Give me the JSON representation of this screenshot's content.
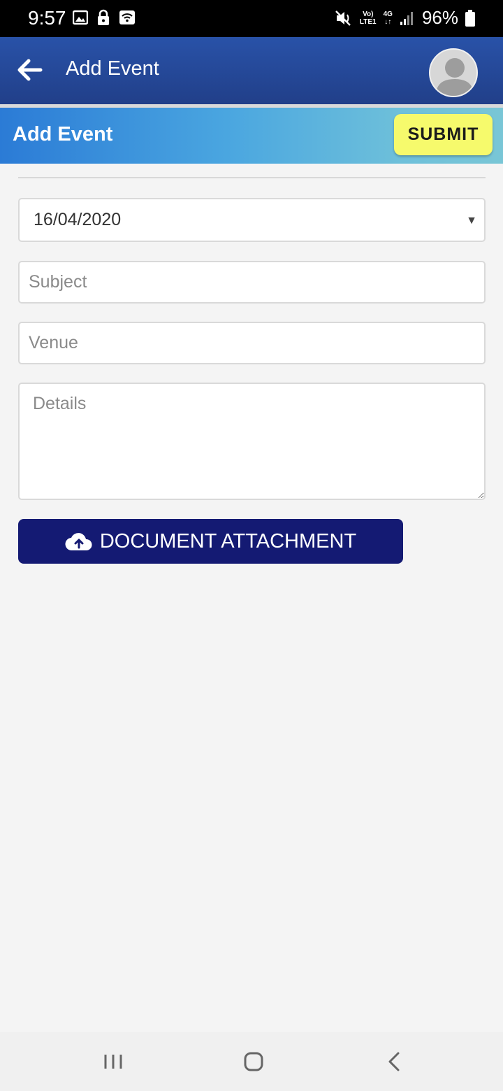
{
  "status_bar": {
    "time": "9:57",
    "battery": "96%",
    "net_top": "Vo)",
    "net_bottom": "LTE1",
    "net_gen": "4G"
  },
  "app_bar": {
    "title": "Add Event"
  },
  "sub_header": {
    "title": "Add Event",
    "submit_label": "SUBMIT"
  },
  "form": {
    "date_value": "16/04/2020",
    "subject_placeholder": "Subject",
    "venue_placeholder": "Venue",
    "details_placeholder": "Details",
    "attachment_label": "DOCUMENT ATTACHMENT"
  },
  "colors": {
    "app_bar": "#2952a8",
    "submit": "#f6fa6c",
    "attachment": "#141a73"
  }
}
